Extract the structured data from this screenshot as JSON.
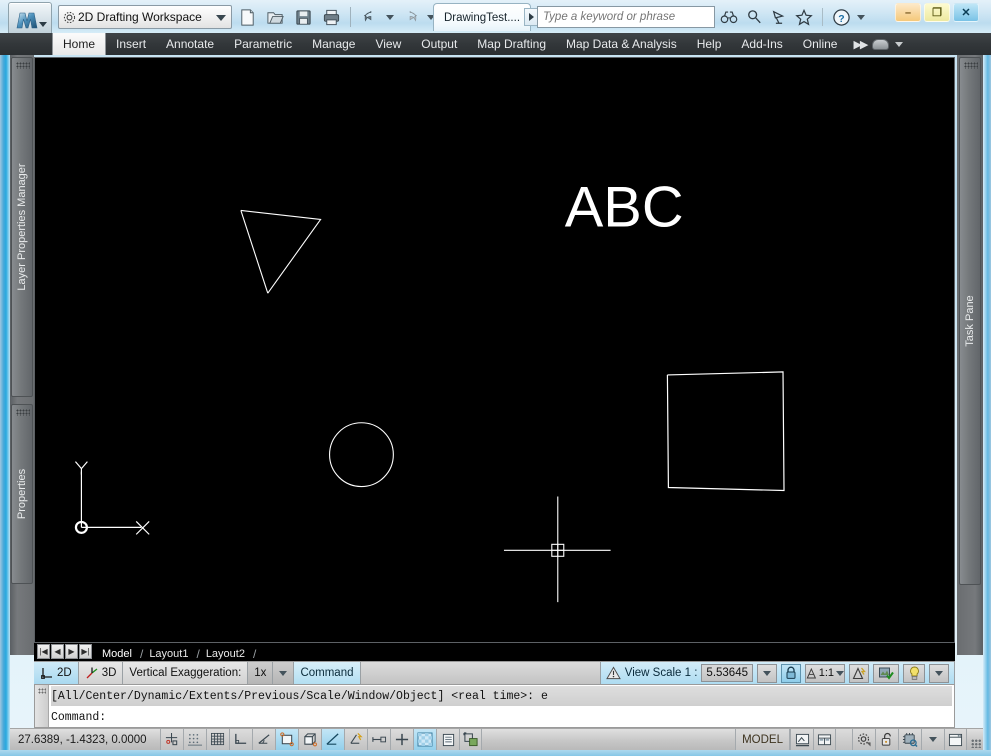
{
  "app": {
    "logo_icon": "autocad-map-3d-logo",
    "mode_label": "3D",
    "workspace": {
      "icon": "gear-icon",
      "label": "2D Drafting Workspace",
      "dropdown_icon": "chevron-down-icon"
    }
  },
  "quick_access": [
    {
      "name": "new-file-button",
      "icon": "new-document-icon"
    },
    {
      "name": "open-file-button",
      "icon": "open-folder-icon"
    },
    {
      "name": "save-button",
      "icon": "floppy-save-icon"
    },
    {
      "name": "plot-button",
      "icon": "printer-icon"
    },
    {
      "name": "undo-button",
      "icon": "undo-arrow-icon"
    },
    {
      "name": "redo-button",
      "icon": "redo-arrow-icon"
    },
    {
      "name": "qat-customize-button",
      "icon": "chevron-down-icon"
    }
  ],
  "document": {
    "tab_label": "DrawingTest....",
    "tab_overflow_icon": "chevron-right-icon"
  },
  "search": {
    "placeholder": "Type a keyword or phrase",
    "value": ""
  },
  "info_center": [
    {
      "name": "search-communication-center-button",
      "icon": "binoculars-icon"
    },
    {
      "name": "search-button",
      "icon": "magnifier-icon"
    },
    {
      "name": "communication-center-button",
      "icon": "satellite-dish-icon"
    },
    {
      "name": "favorites-button",
      "icon": "star-icon"
    },
    {
      "name": "help-button",
      "icon": "question-circle-icon"
    },
    {
      "name": "help-dropdown-button",
      "icon": "chevron-down-icon"
    }
  ],
  "window_controls": {
    "minimize": "–",
    "maximize": "❐",
    "close": "✕"
  },
  "ribbon_tabs": [
    {
      "label": "Home",
      "active": true
    },
    {
      "label": "Insert",
      "active": false
    },
    {
      "label": "Annotate",
      "active": false
    },
    {
      "label": "Parametric",
      "active": false
    },
    {
      "label": "Manage",
      "active": false
    },
    {
      "label": "View",
      "active": false
    },
    {
      "label": "Output",
      "active": false
    },
    {
      "label": "Map Drafting",
      "active": false
    },
    {
      "label": "Map Data & Analysis",
      "active": false
    },
    {
      "label": "Help",
      "active": false
    },
    {
      "label": "Add-Ins",
      "active": false
    },
    {
      "label": "Online",
      "active": false
    }
  ],
  "ribbon_extras": {
    "expand_icon": "double-chevron-right-icon",
    "minimize_ribbon_icon": "ribbon-hat-icon",
    "minimize_ribbon_dropdown_icon": "chevron-down-icon"
  },
  "left_panels": [
    {
      "label": "Layer Properties Manager",
      "name": "panel-tab-layer-properties-manager"
    },
    {
      "label": "Properties",
      "name": "panel-tab-properties"
    }
  ],
  "right_panels": [
    {
      "label": "Task Pane",
      "name": "panel-tab-task-pane"
    }
  ],
  "drawing_window": {
    "background_color": "#000000",
    "entity_color": "#ffffff",
    "minimize": "–",
    "restore": "❐",
    "close": "✕",
    "text_entity": "ABC",
    "ucs_icon": {
      "x_label": "X",
      "y_label": "Y"
    }
  },
  "layout_tabs": {
    "nav": [
      {
        "name": "first-layout-button",
        "glyph": "|◀"
      },
      {
        "name": "previous-layout-button",
        "glyph": "◀"
      },
      {
        "name": "next-layout-button",
        "glyph": "▶"
      },
      {
        "name": "last-layout-button",
        "glyph": "▶|"
      }
    ],
    "tabs": [
      {
        "label": "Model",
        "active": true
      },
      {
        "label": "Layout1",
        "active": false
      },
      {
        "label": "Layout2",
        "active": false
      }
    ]
  },
  "view_toolbar": {
    "btn_2d": {
      "label": "2D",
      "icon": "axis-2d-icon",
      "active": true
    },
    "btn_3d": {
      "label": "3D",
      "icon": "axis-3d-icon",
      "active": false
    },
    "vertical_exaggeration_label": "Vertical Exaggeration:",
    "vertical_exaggeration_value": "1x",
    "vertical_exaggeration_dropdown_icon": "chevron-down-icon",
    "command_label": "Command"
  },
  "view_scale": {
    "warning_icon": "warning-triangle-icon",
    "label": "View Scale  1 :",
    "value": "5.53645",
    "dropdown_icon": "chevron-down-icon",
    "lock_icon": "lock-closed-icon",
    "annotation_scale_value": "1:1",
    "annotation_scale_dropdown_icon": "chevron-down-icon",
    "annotation_visibility_icon": "annotation-visibility-icon",
    "annotation_add_scales_icon": "annotation-add-scales-icon",
    "workspace_switch_icon": "lightbulb-icon",
    "overflow_icon": "chevron-down-icon"
  },
  "command_window": {
    "grip_icon": "drag-grip-icon",
    "history_line": "[All/Center/Dynamic/Extents/Previous/Scale/Window/Object] <real time>: e",
    "prompt_line": "Command:"
  },
  "status_bar": {
    "coordinates": "27.6389, -1.4323, 0.0000",
    "toggles": [
      {
        "name": "infer-constraints-toggle",
        "icon": "infer-constraints-icon",
        "on": false
      },
      {
        "name": "snap-mode-toggle",
        "icon": "snap-grid-dots-icon",
        "on": false
      },
      {
        "name": "grid-display-toggle",
        "icon": "grid-icon",
        "on": false
      },
      {
        "name": "ortho-mode-toggle",
        "icon": "ortho-corner-icon",
        "on": false
      },
      {
        "name": "polar-tracking-toggle",
        "icon": "polar-angle-icon",
        "on": false
      },
      {
        "name": "object-snap-toggle",
        "icon": "osnap-square-icon",
        "on": true
      },
      {
        "name": "3d-object-snap-toggle",
        "icon": "osnap-3d-cube-icon",
        "on": false
      },
      {
        "name": "object-snap-tracking-toggle",
        "icon": "otrack-angle-icon",
        "on": true
      },
      {
        "name": "dynamic-ucs-toggle",
        "icon": "dynamic-ucs-icon",
        "on": false
      },
      {
        "name": "dynamic-input-toggle",
        "icon": "dynamic-input-icon",
        "on": false
      },
      {
        "name": "show-lineweight-toggle",
        "icon": "lineweight-plus-icon",
        "on": false
      },
      {
        "name": "transparency-toggle",
        "icon": "transparency-checker-icon",
        "on": true
      },
      {
        "name": "quick-properties-toggle",
        "icon": "quick-properties-icon",
        "on": false
      },
      {
        "name": "selection-cycling-toggle",
        "icon": "selection-cycling-icon",
        "on": false
      }
    ],
    "space_label": "MODEL",
    "right_buttons": [
      {
        "name": "quick-view-layouts-button",
        "icon": "quick-view-layouts-icon"
      },
      {
        "name": "quick-view-drawings-button",
        "icon": "quick-view-drawings-icon"
      },
      {
        "name": "workspace-switching-button",
        "icon": "gear-icon"
      },
      {
        "name": "toolbar-lock-button",
        "icon": "padlock-open-icon"
      },
      {
        "name": "hardware-acceleration-button",
        "icon": "chip-icon"
      },
      {
        "name": "status-bar-menu-button",
        "icon": "chevron-down-icon"
      },
      {
        "name": "clean-screen-button",
        "icon": "clean-screen-icon"
      }
    ],
    "resize_grip_icon": "resize-grip-icon"
  },
  "theme": {
    "ribbon_dark": "#33373a",
    "aero_blue": "#27a9e0",
    "canvas_black": "#000000",
    "entity_white": "#ffffff",
    "highlight_cyan": "#a9d9f0"
  }
}
